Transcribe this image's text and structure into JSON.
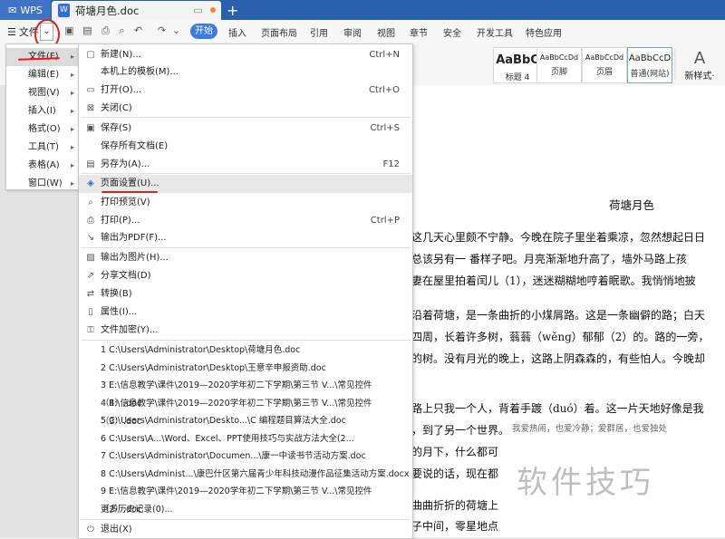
{
  "titlebar": {
    "app": "WPS",
    "doc_tab": "荷塘月色.doc",
    "new_tab": "+"
  },
  "toolbar": {
    "menu_label": "文件",
    "start_tab": "开始",
    "tabs": [
      "插入",
      "页面布局",
      "引用",
      "审阅",
      "视图",
      "章节",
      "安全",
      "开发工具",
      "特色应用"
    ]
  },
  "ribbon": {
    "styles": [
      {
        "preview": "AaBbC",
        "name": "标题 4"
      },
      {
        "preview": "AaBbCcDd",
        "name": "页脚"
      },
      {
        "preview": "AaBbCcDd",
        "name": "页眉"
      },
      {
        "preview": "AaBbCcD",
        "name": "普通(网站)"
      }
    ],
    "new_style_icon": "A",
    "new_style": "新样式·"
  },
  "file_menu": {
    "items": [
      {
        "label": "文件(F)",
        "active": true
      },
      {
        "label": "编辑(E)"
      },
      {
        "label": "视图(V)"
      },
      {
        "label": "插入(I)"
      },
      {
        "label": "格式(O)"
      },
      {
        "label": "工具(T)"
      },
      {
        "label": "表格(A)"
      },
      {
        "label": "窗口(W)"
      }
    ]
  },
  "submenu": {
    "items": [
      {
        "icon": "new-doc-icon",
        "glyph": "▢",
        "label": "新建(N)...",
        "shortcut": "Ctrl+N"
      },
      {
        "icon": "template-icon",
        "glyph": "",
        "label": "本机上的模板(M)...",
        "shortcut": ""
      },
      {
        "icon": "open-folder-icon",
        "glyph": "▭",
        "label": "打开(O)...",
        "shortcut": "Ctrl+O"
      },
      {
        "icon": "close-doc-icon",
        "glyph": "⊠",
        "label": "关闭(C)",
        "shortcut": ""
      },
      {
        "icon": "save-icon",
        "glyph": "▣",
        "label": "保存(S)",
        "shortcut": "Ctrl+S"
      },
      {
        "icon": "save-all-icon",
        "glyph": "",
        "label": "保存所有文档(E)",
        "shortcut": ""
      },
      {
        "icon": "save-as-icon",
        "glyph": "▤",
        "label": "另存为(A)...",
        "shortcut": "F12"
      },
      {
        "icon": "page-setup-icon",
        "glyph": "◈",
        "label": "页面设置(U)...",
        "shortcut": "",
        "highlight": true
      },
      {
        "icon": "print-preview-icon",
        "glyph": "⌕",
        "label": "打印预览(V)",
        "shortcut": ""
      },
      {
        "icon": "print-icon",
        "glyph": "⎙",
        "label": "打印(P)...",
        "shortcut": "Ctrl+P"
      },
      {
        "icon": "export-pdf-icon",
        "glyph": "↘",
        "label": "输出为PDF(F)...",
        "shortcut": ""
      },
      {
        "icon": "export-image-icon",
        "glyph": "▨",
        "label": "输出为图片(H)...",
        "shortcut": ""
      },
      {
        "icon": "share-icon",
        "glyph": "⇗",
        "label": "分享文档(D)",
        "shortcut": ""
      },
      {
        "icon": "convert-icon",
        "glyph": "⇄",
        "label": "转换(B)",
        "shortcut": ""
      },
      {
        "icon": "properties-icon",
        "glyph": "▯",
        "label": "属性(I)...",
        "shortcut": ""
      },
      {
        "icon": "encrypt-icon",
        "glyph": "⚿",
        "label": "文件加密(Y)...",
        "shortcut": ""
      }
    ],
    "recent": [
      "1 C:\\Users\\Administrator\\Desktop\\荷塘月色.doc",
      "2 C:\\Users\\Administrator\\Desktop\\王意辛申报资助.doc",
      "3 E:\\信息教学\\课件\\2019—2020学年初二下学期\\第三节 V...\\常见控件（4）.doc",
      "4 E:\\信息教学\\课件\\2019—2020学年初二下学期\\第三节 V...\\常见控件（3）.doc",
      "5 C:\\Users\\Administrator\\Deskto...\\C 编程题目算法大全.doc",
      "6 C:\\Users\\A...\\Word、Excel、PPT使用技巧与实战方法大全(2...",
      "7 C:\\Users\\Administrator\\Documen...\\康一中读书节活动方案.doc",
      "8 C:\\Users\\Administ...\\康巴什区第六届青少年科技动漫作品征集活动方案.docx",
      "9 E:\\信息教学\\课件\\2019—2020学年初二下学期\\第三节 V...\\常见控件（2）.doc",
      "更多历史记录(0)..."
    ],
    "exit": {
      "icon": "exit-icon",
      "glyph": "⏻",
      "label": "退出(X)"
    }
  },
  "document": {
    "title": "荷塘月色",
    "lines": [
      "这几天心里颇不宁静。今晚在院子里坐着乘凉，忽然想起日日",
      "总该另有一 番样子吧。月亮渐渐地升高了，墙外马路上孩",
      "妻在屋里拍着闰儿（1），迷迷糊糊地哼着眠歌。我悄悄地披",
      "",
      "沿着荷塘，是一条曲折的小煤屑路。这是一条幽僻的路；白天",
      "四周，长着许多树，蓊蓊（wěng）郁郁（2）的。路的一旁，",
      "的树。没有月光的晚上，这路上阴森森的，有些怕人。今晚却",
      "",
      "路上只我一个人，背着手踱（duó）着。这一片天地好像是我",
      "，到了另一个世界。",
      "的月下，什么都可",
      "要说的话，现在都",
      "",
      "曲曲折折的荷塘上",
      "子中间，零星地点"
    ],
    "overlay_line": "我爱热闹，也爱冷静；爱群居，也爱独处",
    "watermark": "软件技巧"
  }
}
